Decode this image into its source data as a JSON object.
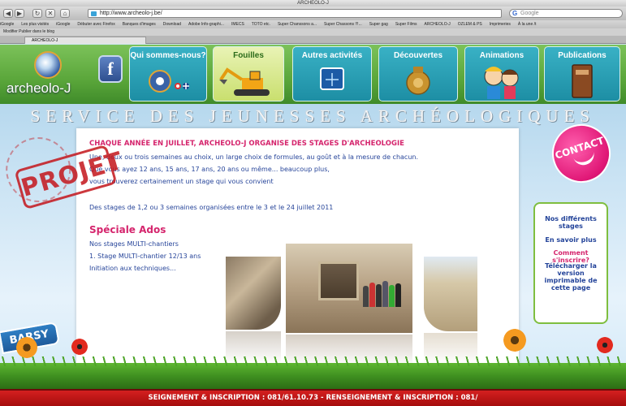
{
  "browser": {
    "window_title": "ARCHEOLO-J",
    "url": "http://www.archeolo-j.be/",
    "search_placeholder": "Google",
    "bookmarks": [
      "iGoogle",
      "Les plus visités",
      "iGoogle",
      "Débuter avec Firefox",
      "Banques d'images",
      "Download",
      "Adobe Info-graphi...",
      "IMECS",
      "TOTO etc.",
      "Super Chanssons a...",
      "Super Chassons !!!...",
      "Super gag",
      "Super Films",
      "ARCHEOLO-J",
      "OZLEM & PS",
      "Imprimeries",
      "À la une /t"
    ],
    "bookmarks2": "Modifier       Publier dans le blog",
    "tab_title": "ARCHEOLO-J"
  },
  "site": {
    "logo_text": "archeolo-J",
    "facebook_label": "f",
    "subtitle": "SERVICE DES JEUNESSES ARCHÉOLOGIQUES",
    "menu": [
      {
        "label": "Qui sommes-nous?"
      },
      {
        "label": "Fouilles"
      },
      {
        "label": "Autres activités"
      },
      {
        "label": "Découvertes"
      },
      {
        "label": "Animations"
      },
      {
        "label": "Publications"
      }
    ],
    "stamp": "PROJET",
    "barsy": "BARSY",
    "contact": "CONTACT"
  },
  "content": {
    "headline": "CHAQUE ANNÉE EN JUILLET, ARCHEOLO-J ORGANISE DES STAGES D'ARCHEOLOGIE",
    "line1": "Une, deux ou trois semaines au choix, un large choix de formules, au goût et à la mesure de chacun.",
    "line2": "Que vous ayez 12 ans, 15 ans, 17 ans, 20 ans ou même... beaucoup plus,",
    "line3": "vous trouverez certainement un stage qui vous convient",
    "line4": "Des stages de 1,2 ou 3 semaines organisées entre le 3 et le 24 juillet 2011",
    "section_title": "Spéciale Ados",
    "item1": "Nos stages MULTI-chantiers",
    "item2": "1. Stage MULTI-chantier 12/13 ans",
    "item3": "Initiation aux techniques..."
  },
  "sidebar": {
    "stages": "Nos différents stages",
    "more": "En savoir plus",
    "enroll": "Comment s'inscrire?",
    "download": "Télécharger la version imprimable de cette page"
  },
  "footer": {
    "text": "SEIGNEMENT & INSCRIPTION : 081/61.10.73 - RENSEIGNEMENT & INSCRIPTION : 081/"
  }
}
